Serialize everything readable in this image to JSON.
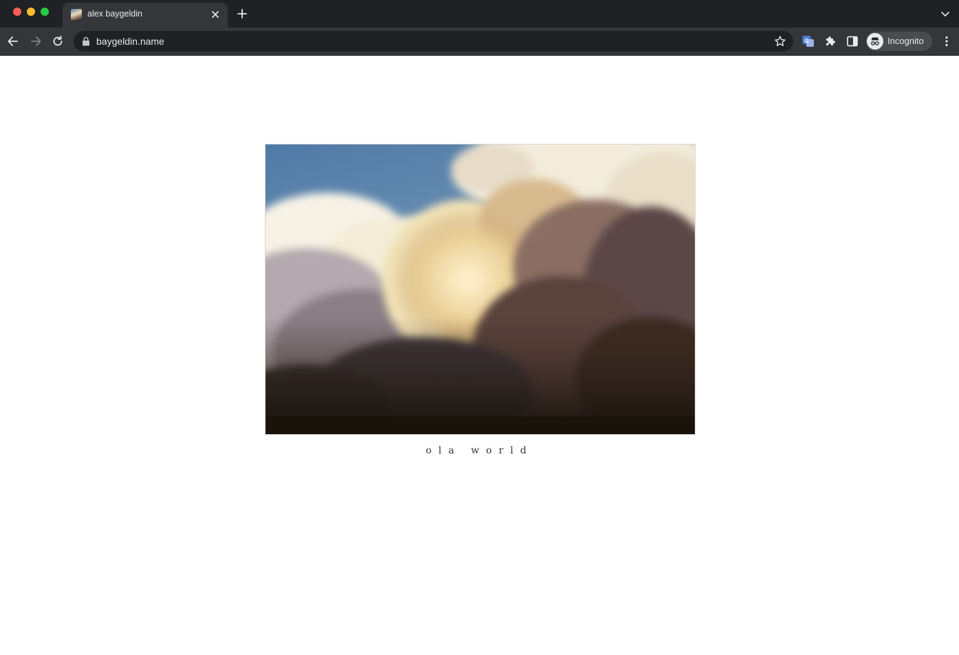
{
  "browser": {
    "tab": {
      "title": "alex baygeldin",
      "favicon": "cloud-photo-favicon"
    },
    "address_bar": {
      "url": "baygeldin.name"
    },
    "profile": {
      "label": "Incognito"
    },
    "icons": {
      "back": "back-arrow-icon",
      "forward": "forward-arrow-icon",
      "reload": "reload-icon",
      "lock": "lock-icon",
      "bookmark": "star-icon",
      "translate": "translate-icon",
      "extensions": "puzzle-icon",
      "side_panel": "side-panel-icon",
      "menu": "kebab-menu-icon"
    },
    "colors": {
      "tabstrip": "#202124",
      "toolbar": "#35363a",
      "text": "#e8eaed",
      "accent": "#4e7ad9"
    }
  },
  "page": {
    "caption": "ola world",
    "photo": {
      "subject": "clouds",
      "colors": {
        "sky": "#5b85b0",
        "cloud_light": "#f2ecd8",
        "cloud_warm": "#d8b07a",
        "cloud_dark": "#4a3a38",
        "ground": "#1c150e"
      }
    }
  }
}
